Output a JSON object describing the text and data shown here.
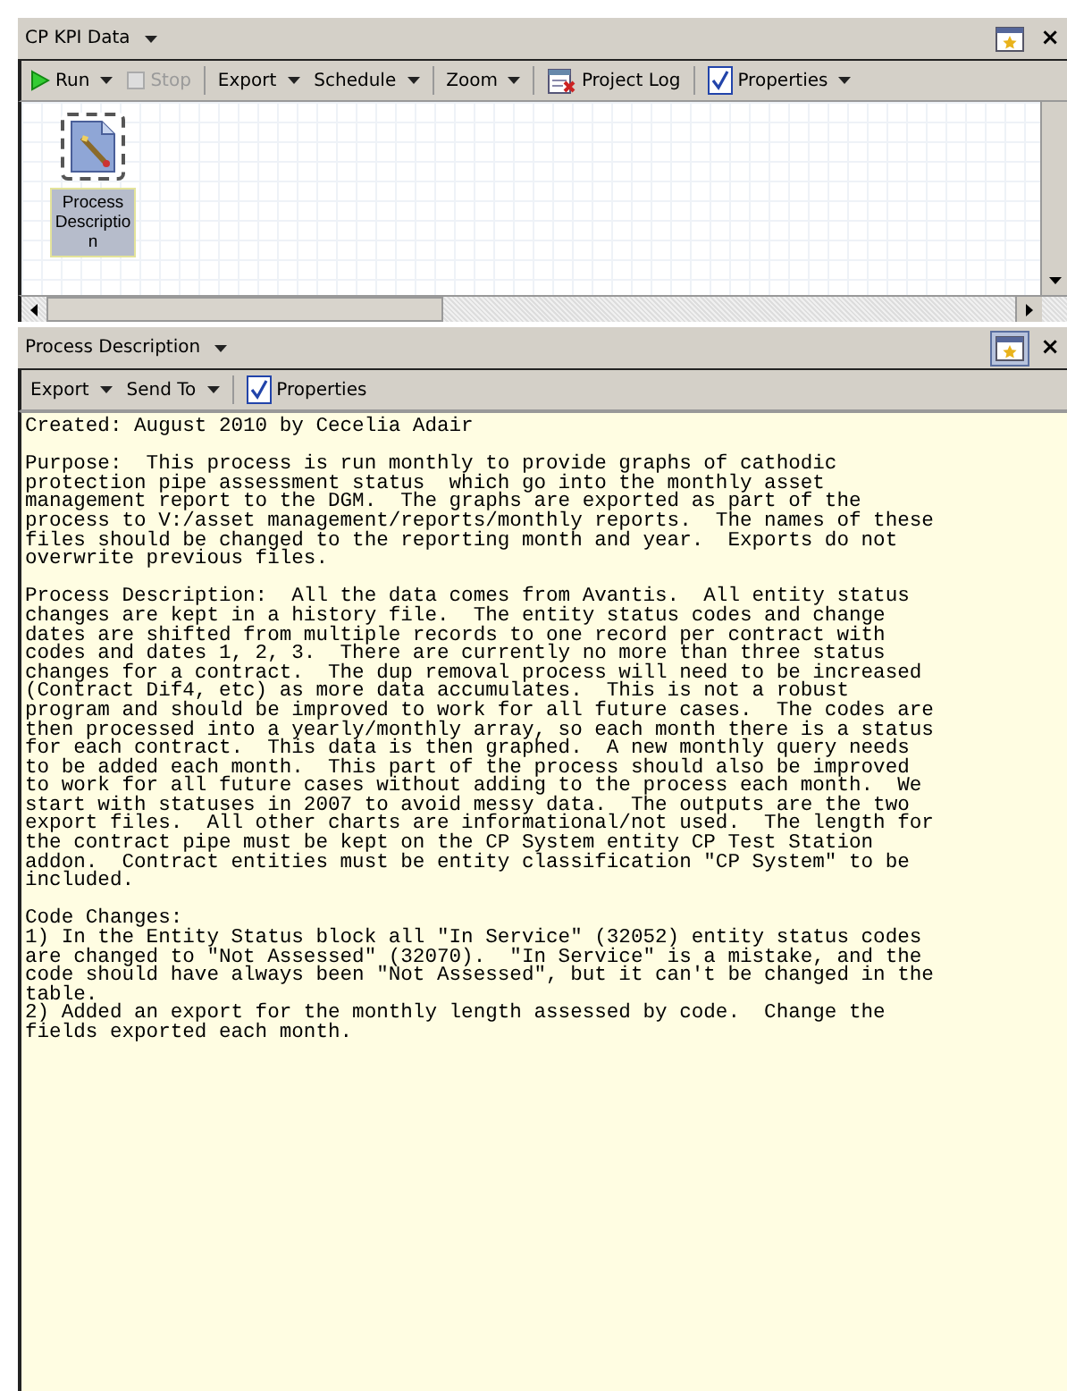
{
  "top_panel": {
    "title": "CP KPI Data",
    "title_dropdown": true,
    "close": "×",
    "toolbar": [
      {
        "kind": "run",
        "label": "Run",
        "dropdown": true,
        "disabled": false
      },
      {
        "kind": "stop",
        "label": "Stop",
        "dropdown": false,
        "disabled": true
      },
      {
        "kind": "sep"
      },
      {
        "kind": "text",
        "label": "Export",
        "dropdown": true,
        "disabled": false
      },
      {
        "kind": "text",
        "label": "Schedule",
        "dropdown": true,
        "disabled": false
      },
      {
        "kind": "sep"
      },
      {
        "kind": "text",
        "label": "Zoom",
        "dropdown": true,
        "disabled": false
      },
      {
        "kind": "sep"
      },
      {
        "kind": "log",
        "label": "Project Log",
        "dropdown": false,
        "disabled": false
      },
      {
        "kind": "sep"
      },
      {
        "kind": "props",
        "label": "Properties",
        "dropdown": true,
        "disabled": false
      }
    ],
    "nodes": [
      {
        "label": "Process Descriptio n",
        "selected": true
      }
    ]
  },
  "bottom_panel": {
    "title": "Process Description",
    "title_dropdown": true,
    "close": "×",
    "toolbar": [
      {
        "kind": "text",
        "label": "Export",
        "dropdown": true,
        "disabled": false
      },
      {
        "kind": "text",
        "label": "Send To",
        "dropdown": true,
        "disabled": false
      },
      {
        "kind": "sep"
      },
      {
        "kind": "props",
        "label": "Properties",
        "dropdown": false,
        "disabled": false
      }
    ],
    "paragraphs": [
      "Created: August 2010 by Cecelia Adair",
      "Purpose:  This process is run monthly to provide graphs of cathodic\nprotection pipe assessment status  which go into the monthly asset\nmanagement report to the DGM.  The graphs are exported as part of the\nprocess to V:/asset management/reports/monthly reports.  The names of these\nfiles should be changed to the reporting month and year.  Exports do not\noverwrite previous files.",
      "Process Description:  All the data comes from Avantis.  All entity status\nchanges are kept in a history file.  The entity status codes and change\ndates are shifted from multiple records to one record per contract with\ncodes and dates 1, 2, 3.  There are currently no more than three status\nchanges for a contract.  The dup removal process will need to be increased\n(Contract Dif4, etc) as more data accumulates.  This is not a robust\nprogram and should be improved to work for all future cases.  The codes are\nthen processed into a yearly/monthly array, so each month there is a status\nfor each contract.  This data is then graphed.  A new monthly query needs\nto be added each month.  This part of the process should also be improved\nto work for all future cases without adding to the process each month.  We\nstart with statuses in 2007 to avoid messy data.  The outputs are the two\nexport files.  All other charts are informational/not used.  The length for\nthe contract pipe must be kept on the CP System entity CP Test Station\naddon.  Contract entities must be entity classification \"CP System\" to be\nincluded.",
      "Code Changes:\n1) In the Entity Status block all \"In Service\" (32052) entity status codes\nare changed to \"Not Assessed\" (32070).  \"In Service\" is a mistake, and the\ncode should have always been \"Not Assessed\", but it can't be changed in the\ntable.\n2) Added an export for the monthly length assessed by code.  Change the\nfields exported each month."
    ]
  }
}
